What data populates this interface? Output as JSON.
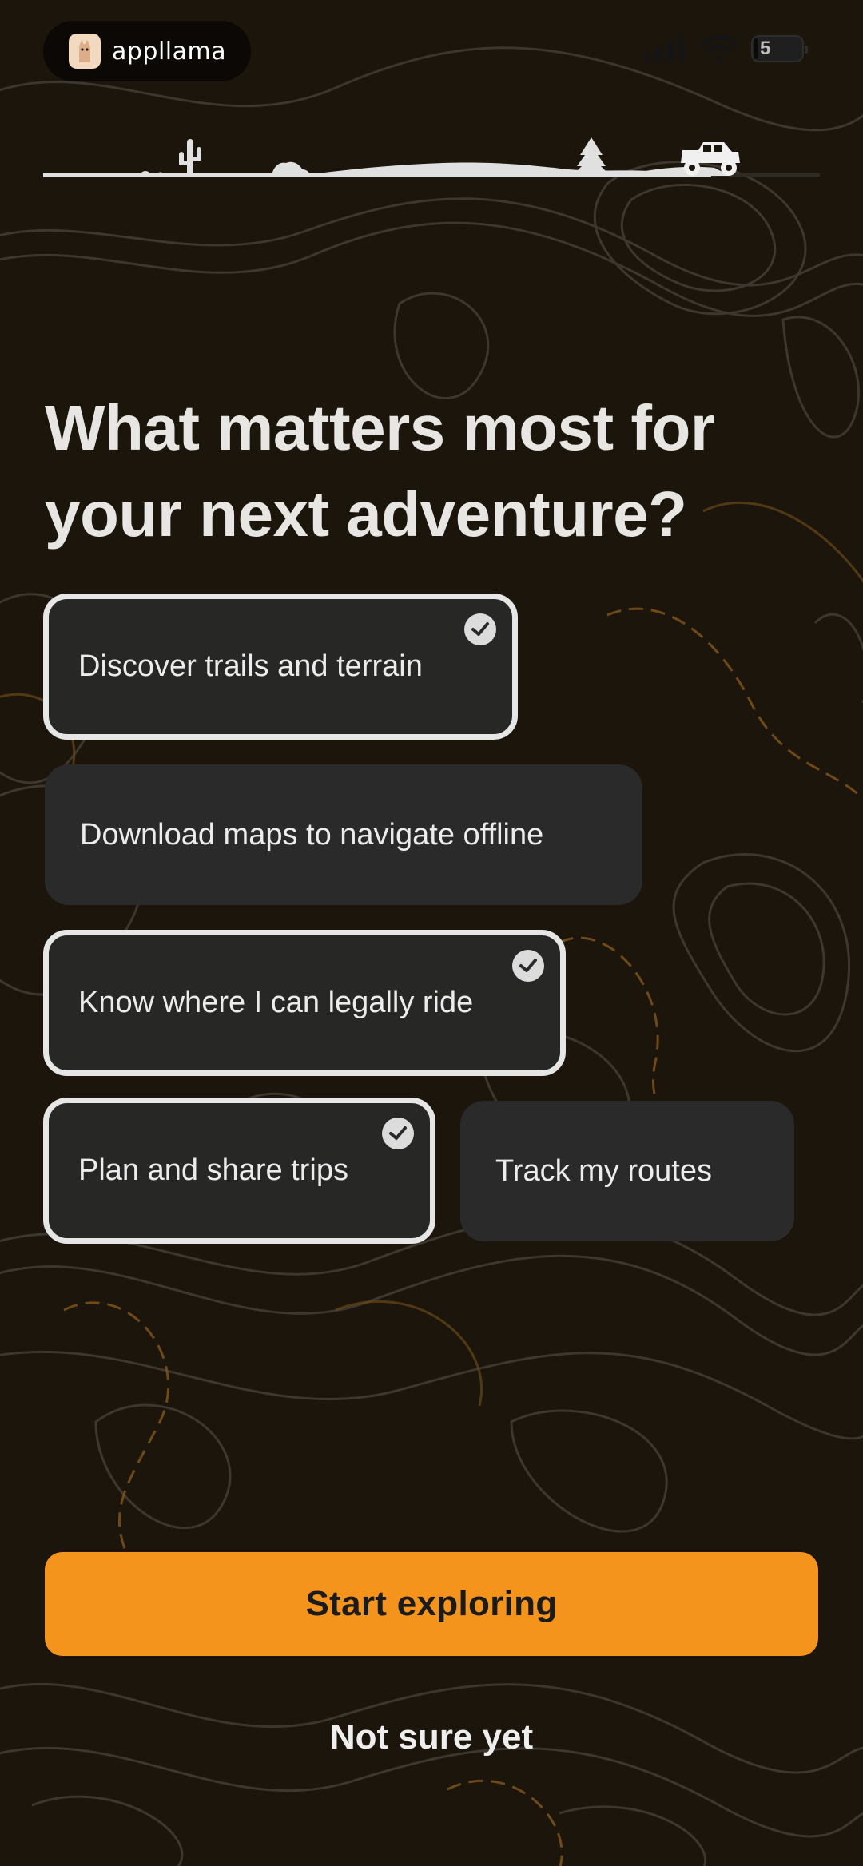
{
  "status_bar": {
    "app_name": "appllama",
    "battery_level": "5",
    "icons": [
      "cellular-signal-icon",
      "wifi-icon",
      "battery-icon"
    ]
  },
  "progress": {
    "icons": [
      "cactus-icon",
      "rock-icon",
      "pine-tree-icon",
      "offroad-vehicle-icon"
    ],
    "completed_fraction": 0.86
  },
  "heading": "What matters most for your next adventure?",
  "options": [
    {
      "label": "Discover trails and terrain",
      "selected": true
    },
    {
      "label": "Download maps to navigate offline",
      "selected": false
    },
    {
      "label": "Know where I can legally ride",
      "selected": true
    },
    {
      "label": "Plan and share trips",
      "selected": true
    },
    {
      "label": "Track my routes",
      "selected": false
    }
  ],
  "actions": {
    "primary_label": "Start exploring",
    "secondary_label": "Not sure yet"
  },
  "colors": {
    "background": "#1c150b",
    "accent": "#f5941d",
    "chip": "#2a2a2a",
    "chip_selected_border": "#e6e6e6",
    "topo_line_gray": "#4a4740",
    "topo_line_orange": "#8a5a1c"
  }
}
